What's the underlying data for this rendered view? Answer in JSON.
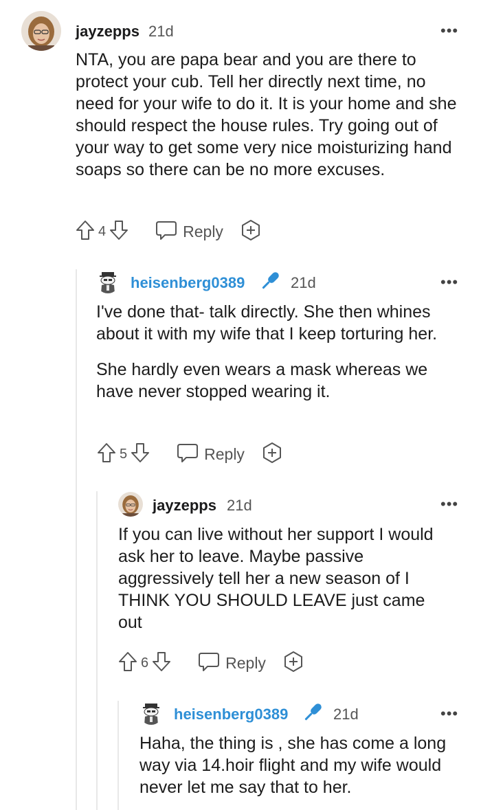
{
  "comments": [
    {
      "username": "jayzepps",
      "time": "21d",
      "more": "•••",
      "paragraphs": [
        "NTA, you are papa bear and you are there to protect your cub. Tell her directly next time, no need for your wife to do it. It is your home and she should respect the house rules. Try going out of your way to get some very nice moisturizing hand soaps so there can be no more excuses."
      ],
      "votes": "4",
      "reply_label": "Reply"
    },
    {
      "username": "heisenberg0389",
      "time": "21d",
      "more": "•••",
      "paragraphs": [
        "I've done that- talk directly. She then whines about it with my wife that I keep torturing her.",
        "She hardly even wears a mask whereas we have never stopped wearing it."
      ],
      "votes": "5",
      "reply_label": "Reply"
    },
    {
      "username": "jayzepps",
      "time": "21d",
      "more": "•••",
      "paragraphs": [
        "If you can live without her support I would ask her to leave. Maybe passive aggressively tell her a new season of I THINK YOU SHOULD LEAVE just came out"
      ],
      "votes": "6",
      "reply_label": "Reply"
    },
    {
      "username": "heisenberg0389",
      "time": "21d",
      "more": "•••",
      "paragraphs": [
        "Haha, the thing is , she has come a long way via 14.hoir flight and my wife would never let me say that to her."
      ]
    }
  ],
  "colors": {
    "op_username": "#1a1a1b",
    "author_username": "#2e8fd6",
    "mic_icon": "#2e8fd6",
    "meta": "#555555",
    "thread_line": "#e8e8e8"
  },
  "icons": [
    "upvote-icon",
    "downvote-icon",
    "reply-icon",
    "award-icon",
    "microphone-icon",
    "more-icon"
  ]
}
